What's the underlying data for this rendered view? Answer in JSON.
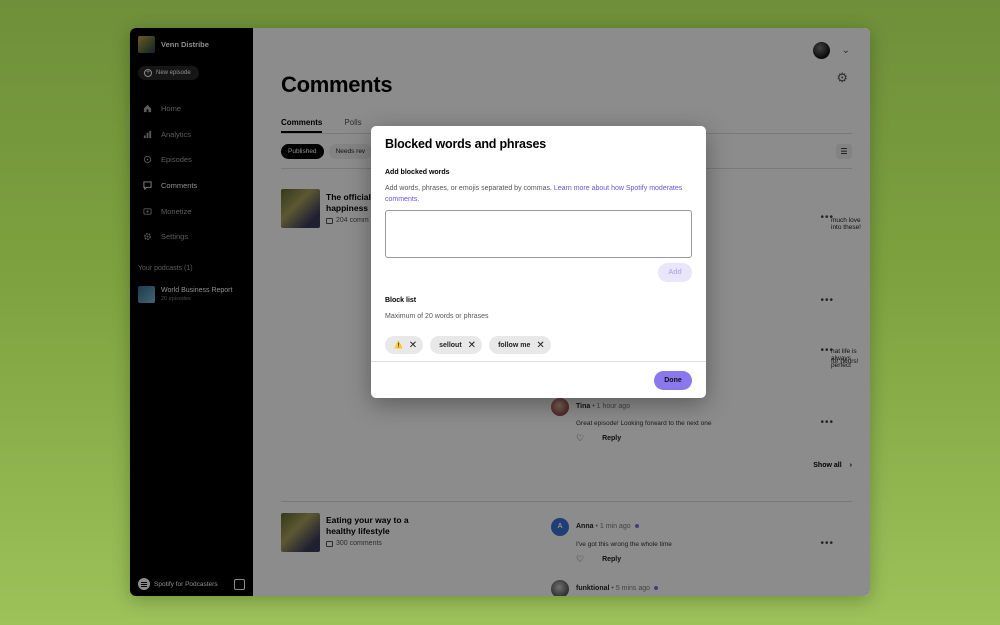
{
  "sidebar": {
    "show_name": "Venn Distribe",
    "new_episode": "New episode",
    "nav": [
      {
        "label": "Home",
        "icon": "home-icon"
      },
      {
        "label": "Analytics",
        "icon": "analytics-icon"
      },
      {
        "label": "Episodes",
        "icon": "episodes-icon"
      },
      {
        "label": "Comments",
        "icon": "comments-icon",
        "active": true
      },
      {
        "label": "Monetize",
        "icon": "monetize-icon"
      },
      {
        "label": "Settings",
        "icon": "settings-icon"
      }
    ],
    "podcasts_title": "Your podcasts (1)",
    "podcast": {
      "name": "World Business Report",
      "sub": "20 episodes"
    },
    "footer_brand": "Spotify for Podcasters"
  },
  "main": {
    "title": "Comments",
    "tabs": [
      "Comments",
      "Polls"
    ],
    "filters": [
      "Published",
      "Needs rev"
    ],
    "episode1": {
      "title": "The official to happiness",
      "count": "204 comm"
    },
    "snippet1": "much love into these!",
    "snippet2a": "hat life is always perfect",
    "snippet2b": "for hours!",
    "comment_tina": {
      "name": "Tina",
      "time": "1 hour ago",
      "body": "Great episode! Looking forward to the next one",
      "reply": "Reply"
    },
    "show_all": "Show all",
    "episode2": {
      "title": "Eating your way to a healthy lifestyle",
      "count": "300 comments"
    },
    "comment_anna": {
      "avatar_letter": "A",
      "name": "Anna",
      "time": "1 min ago",
      "body": "I've got this wrong the whole time",
      "reply": "Reply"
    },
    "comment_funk": {
      "name": "funktional",
      "time": "5 mins ago"
    }
  },
  "modal": {
    "title": "Blocked words and phrases",
    "add_label": "Add blocked words",
    "add_helper": "Add words, phrases, or emojis separated by commas. ",
    "learn_more": "Learn more about how Spotify moderates comments.",
    "textarea_value": "",
    "add_button": "Add",
    "block_list_label": "Block list",
    "block_list_helper": "Maximum of 20 words or phrases",
    "tags": [
      "⚠️",
      "sellout",
      "follow me"
    ],
    "done_button": "Done"
  }
}
